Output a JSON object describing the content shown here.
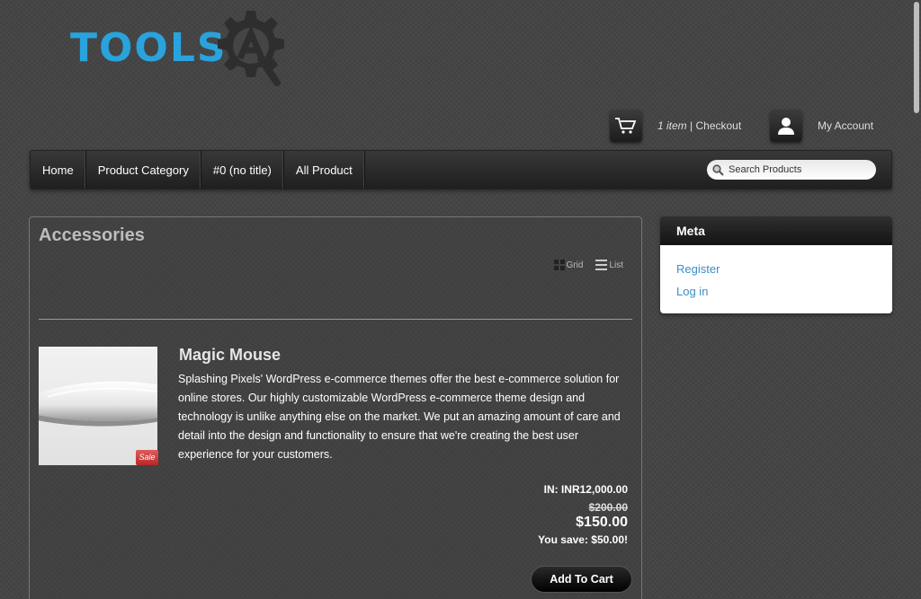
{
  "logo": {
    "text": "TOOLS",
    "color": "#29a3dd"
  },
  "header": {
    "cart_count": "1 item",
    "separator": " | ",
    "checkout": "Checkout",
    "account": "My Account"
  },
  "nav": {
    "items": [
      {
        "label": "Home"
      },
      {
        "label": "Product Category"
      },
      {
        "label": "#0 (no title)"
      },
      {
        "label": "All Product"
      }
    ],
    "search_placeholder": "Search Products"
  },
  "main": {
    "title": "Accessories",
    "view_grid": "Grid",
    "view_list": "List"
  },
  "product": {
    "name": "Magic Mouse",
    "description": "Splashing Pixels' WordPress e-commerce themes offer the best e-commerce solution for online stores. Our highly customizable WordPress e-commerce theme design and technology is unlike anything else on the market. We put an amazing amount of care and detail into the design and functionality to ensure that we're creating the best user experience for your customers.",
    "badge": "Sale",
    "in_price": "IN: INR12,000.00",
    "old_price": "$200.00",
    "new_price": "$150.00",
    "you_save": "You save: $50.00!",
    "add_to_cart": "Add To Cart"
  },
  "sidebar": {
    "meta": {
      "title": "Meta",
      "links": [
        {
          "label": "Register"
        },
        {
          "label": "Log in"
        }
      ]
    }
  },
  "colors": {
    "link": "#3a8fc4",
    "sale": "#c8302f",
    "background": "#454545"
  }
}
